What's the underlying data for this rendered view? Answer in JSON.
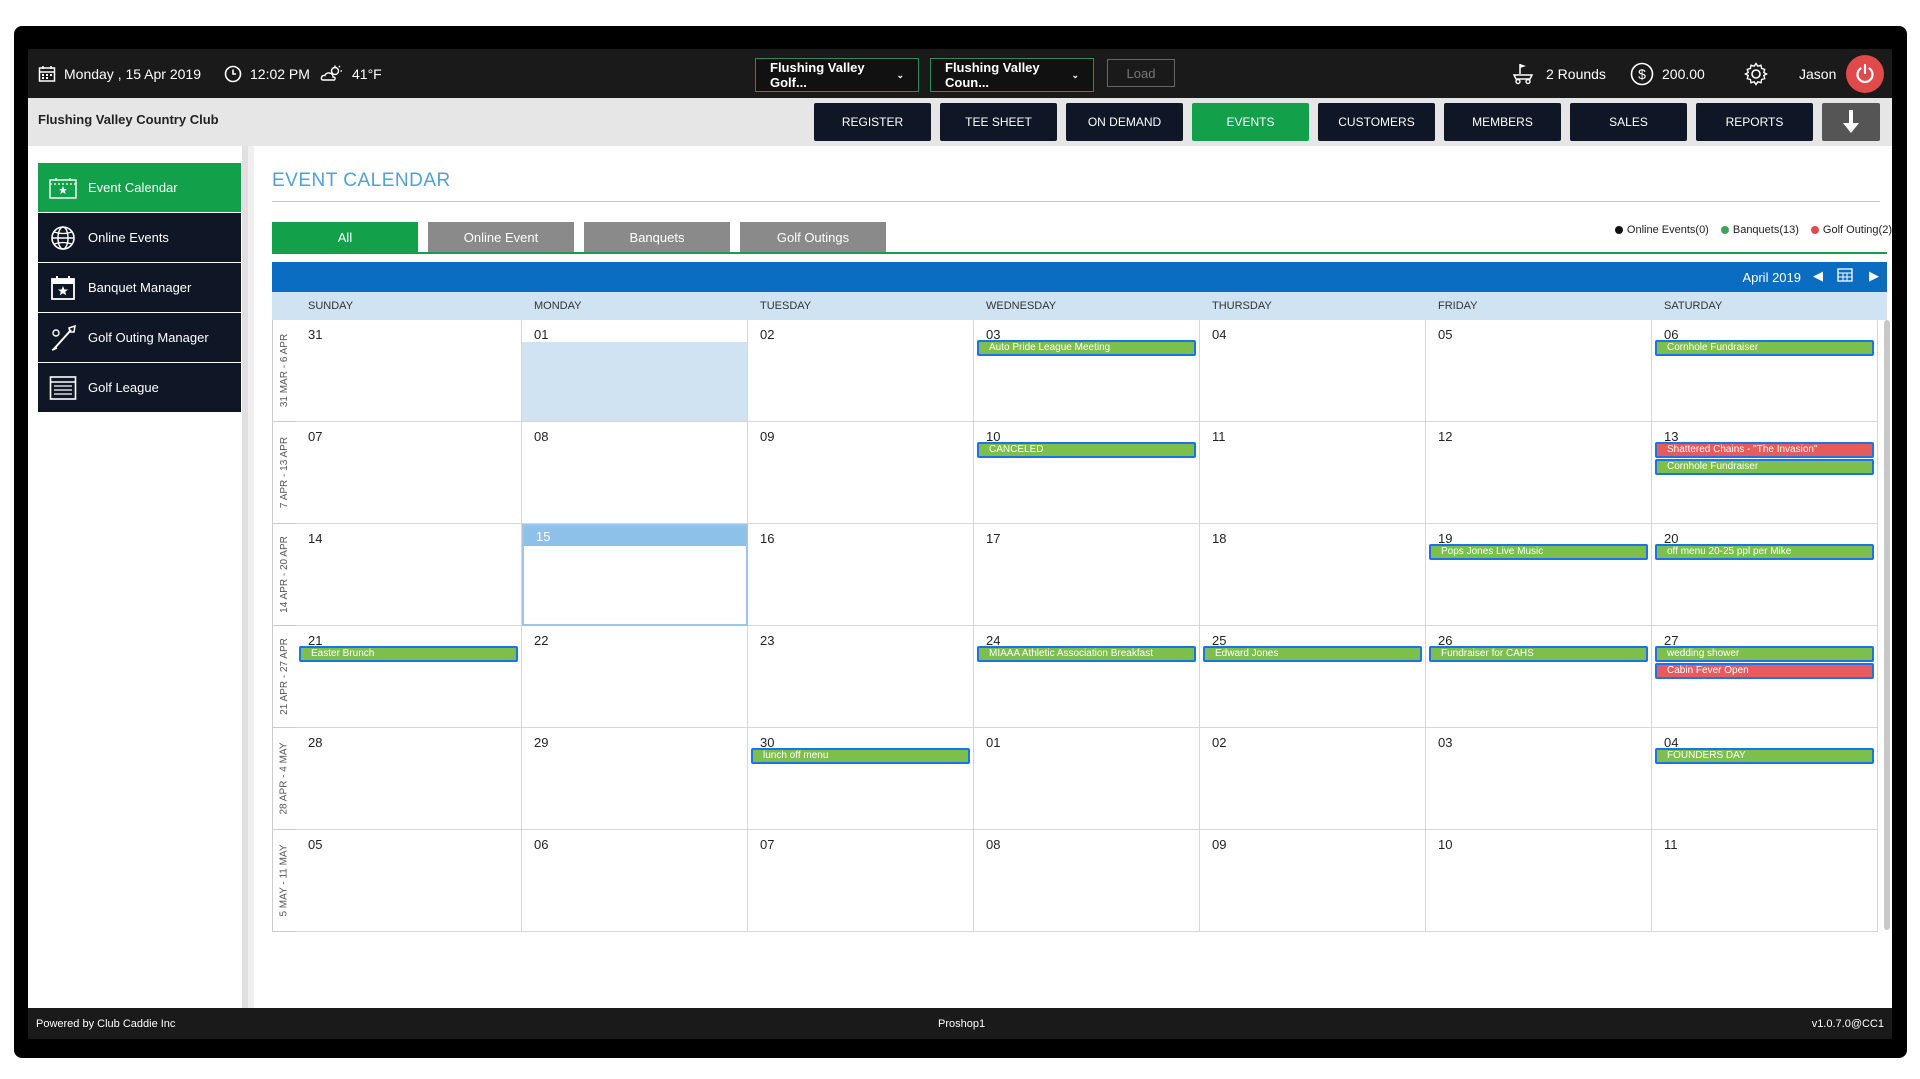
{
  "topbar": {
    "date": "Monday , 15 Apr 2019",
    "time": "12:02 PM",
    "weather": "41°F",
    "course_select": "Flushing Valley Golf...",
    "club_select": "Flushing Valley Coun...",
    "load_label": "Load",
    "rounds": "2 Rounds",
    "balance": "200.00",
    "user": "Jason"
  },
  "navbar": {
    "club_name": "Flushing Valley Country Club",
    "buttons": [
      "REGISTER",
      "TEE SHEET",
      "ON DEMAND",
      "EVENTS",
      "CUSTOMERS",
      "MEMBERS",
      "SALES",
      "REPORTS"
    ],
    "active": "EVENTS"
  },
  "sidebar": {
    "items": [
      {
        "label": "Event Calendar",
        "icon": "calendar-icon"
      },
      {
        "label": "Online Events",
        "icon": "globe-icon"
      },
      {
        "label": "Banquet Manager",
        "icon": "banquet-calendar-icon"
      },
      {
        "label": "Golf Outing Manager",
        "icon": "golf-club-icon"
      },
      {
        "label": "Golf League",
        "icon": "list-icon"
      }
    ]
  },
  "main": {
    "title": "EVENT CALENDAR",
    "filters": [
      "All",
      "Online Event",
      "Banquets",
      "Golf Outings"
    ],
    "legend": [
      {
        "label": "Online Events(0)",
        "color": "#111111"
      },
      {
        "label": "Banquets(13)",
        "color": "#3aa655"
      },
      {
        "label": "Golf Outing(2)",
        "color": "#e04a4a"
      }
    ],
    "month": "April 2019",
    "days_of_week": [
      "SUNDAY",
      "MONDAY",
      "TUESDAY",
      "WEDNESDAY",
      "THURSDAY",
      "FRIDAY",
      "SATURDAY"
    ],
    "weeks": [
      {
        "label": "31 MAR - 6 APR",
        "days": [
          "31",
          "01",
          "02",
          "03",
          "04",
          "05",
          "06"
        ]
      },
      {
        "label": "7 APR - 13 APR",
        "days": [
          "07",
          "08",
          "09",
          "10",
          "11",
          "12",
          "13"
        ]
      },
      {
        "label": "14 APR - 20 APR",
        "days": [
          "14",
          "15",
          "16",
          "17",
          "18",
          "19",
          "20"
        ]
      },
      {
        "label": "21 APR - 27 APR",
        "days": [
          "21",
          "22",
          "23",
          "24",
          "25",
          "26",
          "27"
        ]
      },
      {
        "label": "28 APR - 4 MAY",
        "days": [
          "28",
          "29",
          "30",
          "01",
          "02",
          "03",
          "04"
        ]
      },
      {
        "label": "5 MAY - 11 MAY",
        "days": [
          "05",
          "06",
          "07",
          "08",
          "09",
          "10",
          "11"
        ]
      }
    ],
    "events": [
      {
        "week": 0,
        "day": 3,
        "slot": 0,
        "title": "Auto Pride League Meeting",
        "color": "green"
      },
      {
        "week": 0,
        "day": 6,
        "slot": 0,
        "title": "Cornhole Fundraiser",
        "color": "green"
      },
      {
        "week": 1,
        "day": 3,
        "slot": 0,
        "title": "CANCELED",
        "color": "green"
      },
      {
        "week": 1,
        "day": 6,
        "slot": 0,
        "title": "Shattered Chains - \"The Invasion\"",
        "color": "red"
      },
      {
        "week": 1,
        "day": 6,
        "slot": 1,
        "title": "Cornhole Fundraiser",
        "color": "green"
      },
      {
        "week": 2,
        "day": 5,
        "slot": 0,
        "title": "Pops Jones Live Music",
        "color": "green"
      },
      {
        "week": 2,
        "day": 6,
        "slot": 0,
        "title": "off menu 20-25 ppl per Mike",
        "color": "green"
      },
      {
        "week": 3,
        "day": 0,
        "slot": 0,
        "title": "Easter Brunch",
        "color": "green"
      },
      {
        "week": 3,
        "day": 3,
        "slot": 0,
        "title": "MIAAA Athletic Association Breakfast",
        "color": "green"
      },
      {
        "week": 3,
        "day": 4,
        "slot": 0,
        "title": "Edward Jones",
        "color": "green"
      },
      {
        "week": 3,
        "day": 5,
        "slot": 0,
        "title": "Fundraiser for CAHS",
        "color": "green"
      },
      {
        "week": 3,
        "day": 6,
        "slot": 0,
        "title": "wedding shower",
        "color": "green"
      },
      {
        "week": 3,
        "day": 6,
        "slot": 1,
        "title": "Cabin Fever Open",
        "color": "red"
      },
      {
        "week": 4,
        "day": 2,
        "slot": 0,
        "title": "lunch off menu",
        "color": "green"
      },
      {
        "week": 4,
        "day": 6,
        "slot": 0,
        "title": "FOUNDERS DAY",
        "color": "green"
      }
    ],
    "shaded": {
      "week": 0,
      "day": 1
    },
    "today": {
      "week": 2,
      "day": 1
    }
  },
  "footer": {
    "left": "Powered by Club Caddie Inc",
    "center": "Proshop1",
    "right": "v1.0.7.0@CC1"
  }
}
